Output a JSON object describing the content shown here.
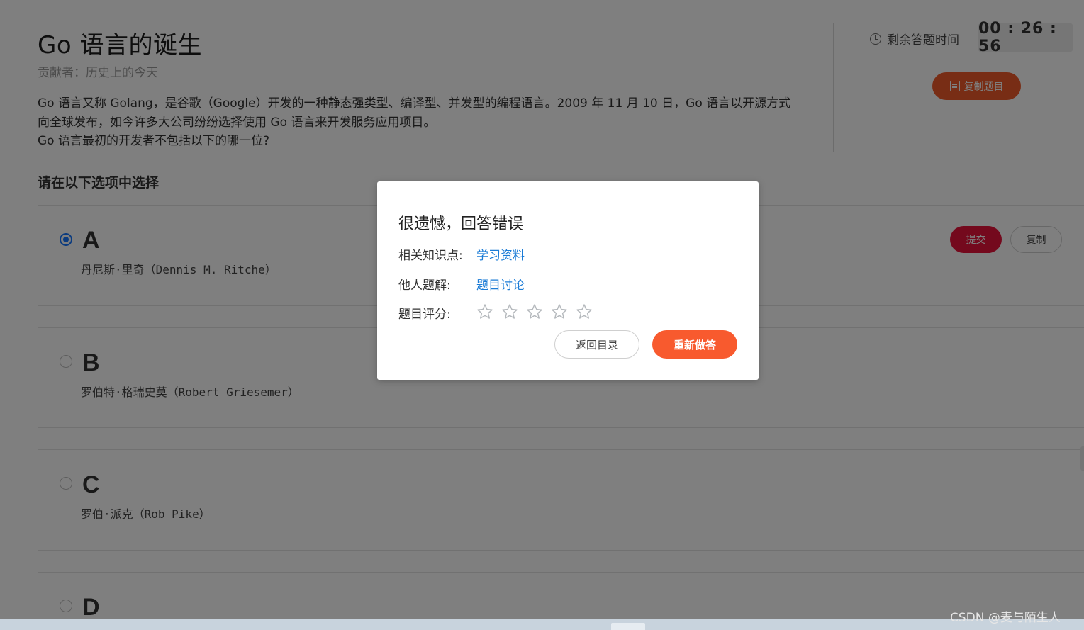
{
  "question": {
    "title": "Go 语言的诞生",
    "contributor": "贡献者：历史上的今天",
    "description_lines": [
      "Go 语言又称 Golang，是谷歌（Google）开发的一种静态强类型、编译型、并发型的编程语言。2009 年 11 月 10 日，Go 语言以开源方式",
      "向全球发布，如今许多大公司纷纷选择使用 Go 语言来开发服务应用项目。",
      "Go 语言最初的开发者不包括以下的哪一位?"
    ],
    "section_title": "请在以下选项中选择"
  },
  "sidebar": {
    "timer_label": "剩余答题时间",
    "timer_value": "00 : 26 : 56",
    "copy_question_label": "复制题目"
  },
  "options": [
    {
      "letter": "A",
      "text": "丹尼斯·里奇（Dennis M. Ritche）",
      "selected": true
    },
    {
      "letter": "B",
      "text": "罗伯特·格瑞史莫（Robert Griesemer）",
      "selected": false
    },
    {
      "letter": "C",
      "text": "罗伯·派克（Rob Pike）",
      "selected": false
    },
    {
      "letter": "D",
      "text": "",
      "selected": false
    }
  ],
  "actions": {
    "submit_label": "提交",
    "copy_label": "复制"
  },
  "modal": {
    "title": "很遗憾，回答错误",
    "knowledge_label": "相关知识点:",
    "knowledge_link": "学习资料",
    "solutions_label": "他人题解:",
    "solutions_link": "题目讨论",
    "rating_label": "题目评分:",
    "rating": 0,
    "rating_max": 5,
    "back_label": "返回目录",
    "redo_label": "重新做答"
  },
  "watermark": "CSDN @麦与陌生人",
  "colors": {
    "accent_orange": "#f85a2e",
    "submit_red": "#e8123a",
    "link_blue": "#1a7bd6",
    "radio_blue": "#1677ff"
  }
}
